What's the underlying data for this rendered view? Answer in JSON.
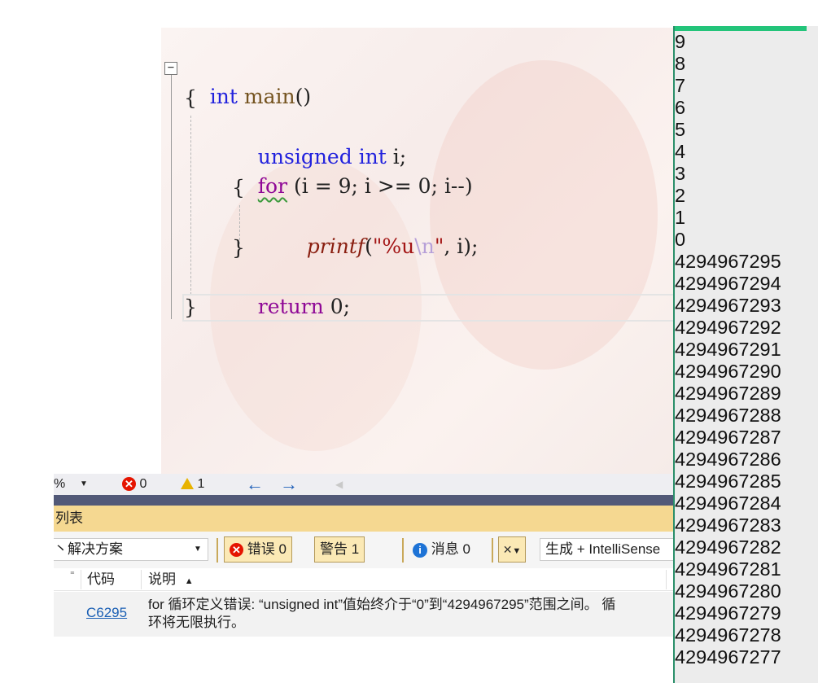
{
  "editor": {
    "collapse_glyph": "−",
    "lines": {
      "l1_kw": "int",
      "l1_fn": "main",
      "l1_rest": "()",
      "l2": "{",
      "l3_kw1": "unsigned",
      "l3_kw2": "int",
      "l3_rest": "i;",
      "l4_kw": "for",
      "l4_rest": "(i = 9; i >= 0; i--)",
      "l5": "{",
      "l6_fn": "printf",
      "l6_open": "(",
      "l6_q1": "\"",
      "l6_fmt": "%u",
      "l6_esc": "\\n",
      "l6_q2": "\"",
      "l6_rest": ", i);",
      "l7": "}",
      "l8_kw": "return",
      "l8_rest": "0;",
      "l9": "}"
    }
  },
  "status_strip": {
    "zoom_fragment": "%",
    "errors": "0",
    "warnings": "1",
    "back_arrow": "←",
    "forward_arrow": "→",
    "left_tri": "◀"
  },
  "error_list": {
    "panel_title": "列表",
    "scope": "解决方案",
    "scope_prefix": "丶",
    "errors_btn": "错误 0",
    "warnings_btn": "警告 1",
    "messages_btn": "消息 0",
    "source": "生成 + IntelliSense",
    "col_code": "代码",
    "col_desc": "说明",
    "sort_arrow": "▲",
    "row": {
      "code": "C6295",
      "desc_line1": "for 循环定义错误: “unsigned int”值始终介于“0”到“4294967295”范围之间。 循",
      "desc_line2": "环将无限执行。"
    }
  },
  "console": {
    "lines": [
      "9",
      "8",
      "7",
      "6",
      "5",
      "4",
      "3",
      "2",
      "1",
      "0",
      "4294967295",
      "4294967294",
      "4294967293",
      "4294967292",
      "4294967291",
      "4294967290",
      "4294967289",
      "4294967288",
      "4294967287",
      "4294967286",
      "4294967285",
      "4294967284",
      "4294967283",
      "4294967282",
      "4294967281",
      "4294967280",
      "4294967279",
      "4294967278",
      "4294967277"
    ]
  },
  "colors": {
    "accent_green": "#23c47a",
    "panel_header": "#f5d891",
    "error_red": "#e51400",
    "warning_yellow": "#e8b300",
    "link_blue": "#1a5fb4"
  }
}
